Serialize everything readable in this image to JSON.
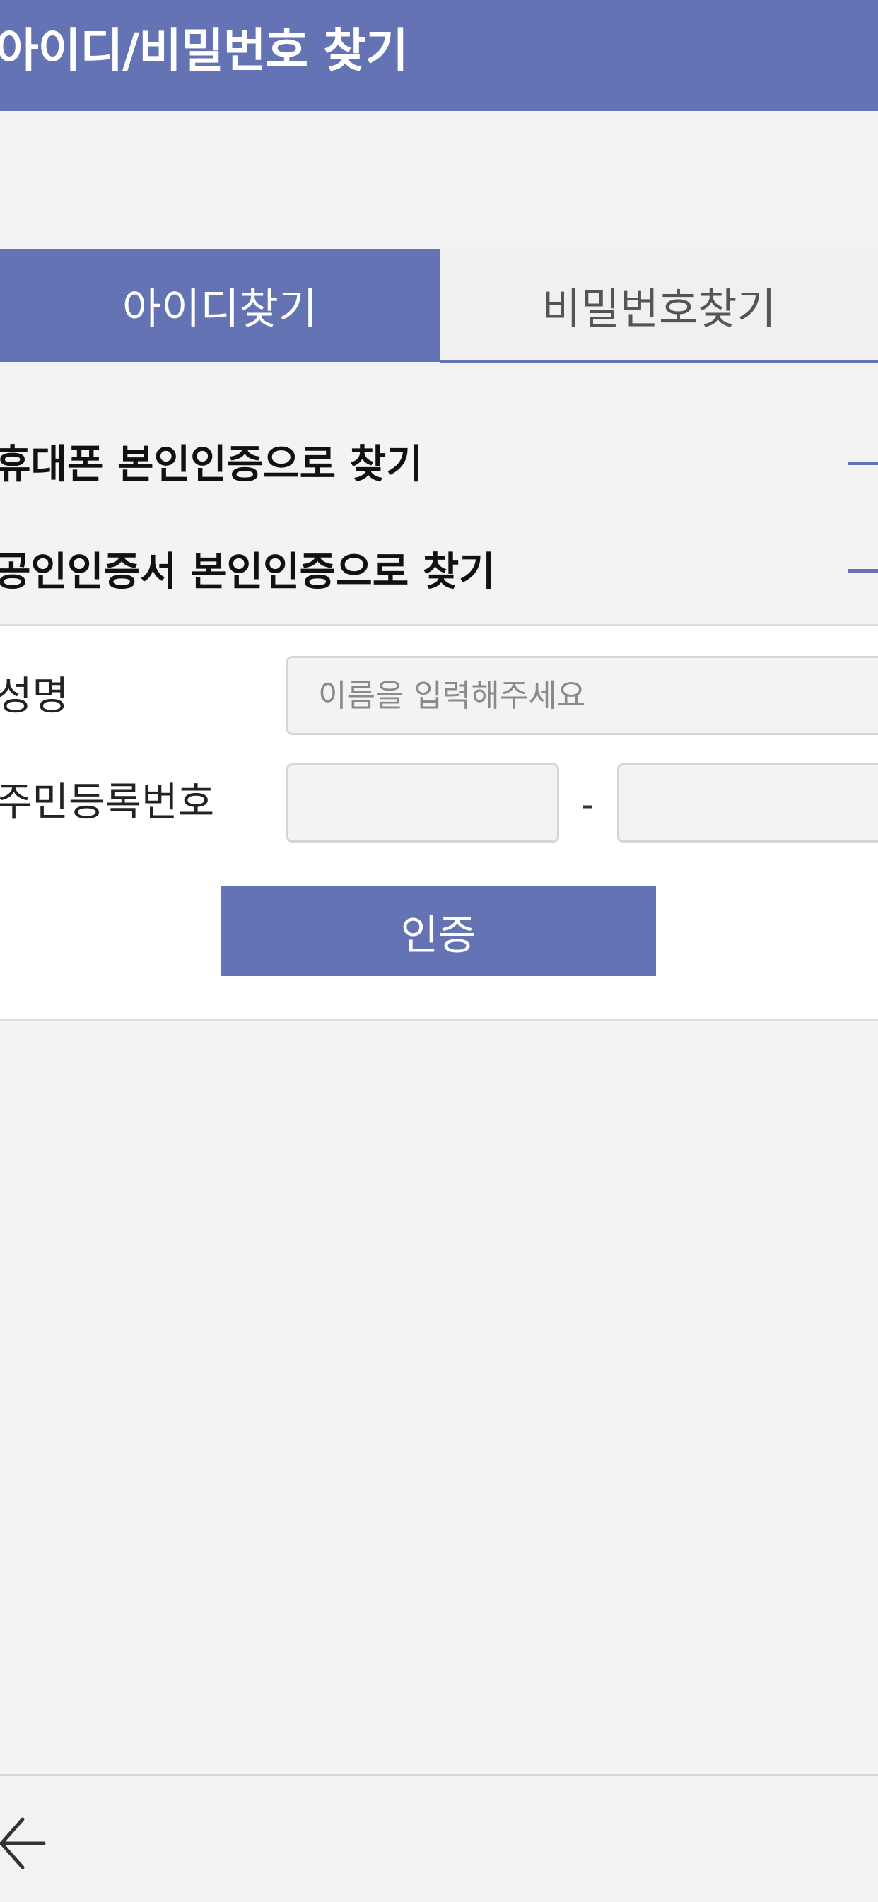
{
  "theme": {
    "accent": "#6473b3"
  },
  "header": {
    "title": "아이디/비밀번호 찾기"
  },
  "tabs": [
    {
      "label": "아이디찾기",
      "active": true
    },
    {
      "label": "비밀번호찾기",
      "active": false
    }
  ],
  "sections": [
    {
      "label": "휴대폰 본인인증으로 찾기",
      "icon": "minus-icon"
    },
    {
      "label": "공인인증서 본인인증으로 찾기",
      "icon": "minus-icon"
    }
  ],
  "form": {
    "name_label": "성명",
    "name_placeholder": "이름을 입력해주세요",
    "rrn_label": "주민등록번호",
    "rrn_separator": "-",
    "submit_label": "인증"
  },
  "footer": {
    "back_icon": "back-arrow-icon"
  }
}
